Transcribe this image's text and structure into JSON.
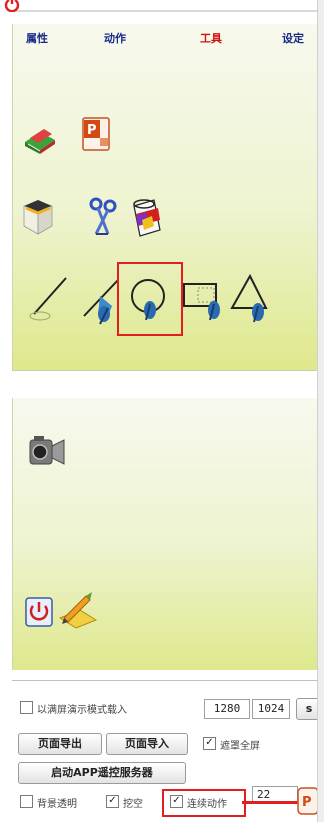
{
  "tabs": [
    {
      "label": "属性",
      "color": "#1a2a8a"
    },
    {
      "label": "动作",
      "color": "#1a2a8a"
    },
    {
      "label": "工具",
      "color": "#d01010"
    },
    {
      "label": "设定",
      "color": "#1a2a8a"
    }
  ],
  "icons": {
    "row1": [
      "book-icon",
      "powerpoint-icon"
    ],
    "row2": [
      "box-icon",
      "scissors-icon",
      "paint-bucket-icon"
    ],
    "row3": [
      "pen-icon",
      "line-pen-icon",
      "circle-pen-icon",
      "rectangle-pen-icon",
      "triangle-pen-icon"
    ],
    "panel2": [
      "camera-icon",
      "power-icon",
      "pencil-paper-icon"
    ]
  },
  "bottom": {
    "fullscreen_import_label": "以满屏演示模式载入",
    "fullscreen_import_checked": false,
    "width_value": "1280",
    "height_value": "1024",
    "s_button": "s",
    "page_export": "页面导出",
    "page_import": "页面导入",
    "mask_fullscreen_label": "遮罩全屏",
    "mask_fullscreen_checked": true,
    "start_app_server": "启动APP遥控服务器",
    "bg_transparent_label": "背景透明",
    "bg_transparent_checked": false,
    "hollow_label": "挖空",
    "hollow_checked": true,
    "continuous_label": "连续动作",
    "continuous_checked": true,
    "number_value": "22",
    "check_mark": "✓"
  },
  "colors": {
    "highlight": "#e02020",
    "tab_active": "#d01010",
    "tab_normal": "#1a2a8a"
  }
}
